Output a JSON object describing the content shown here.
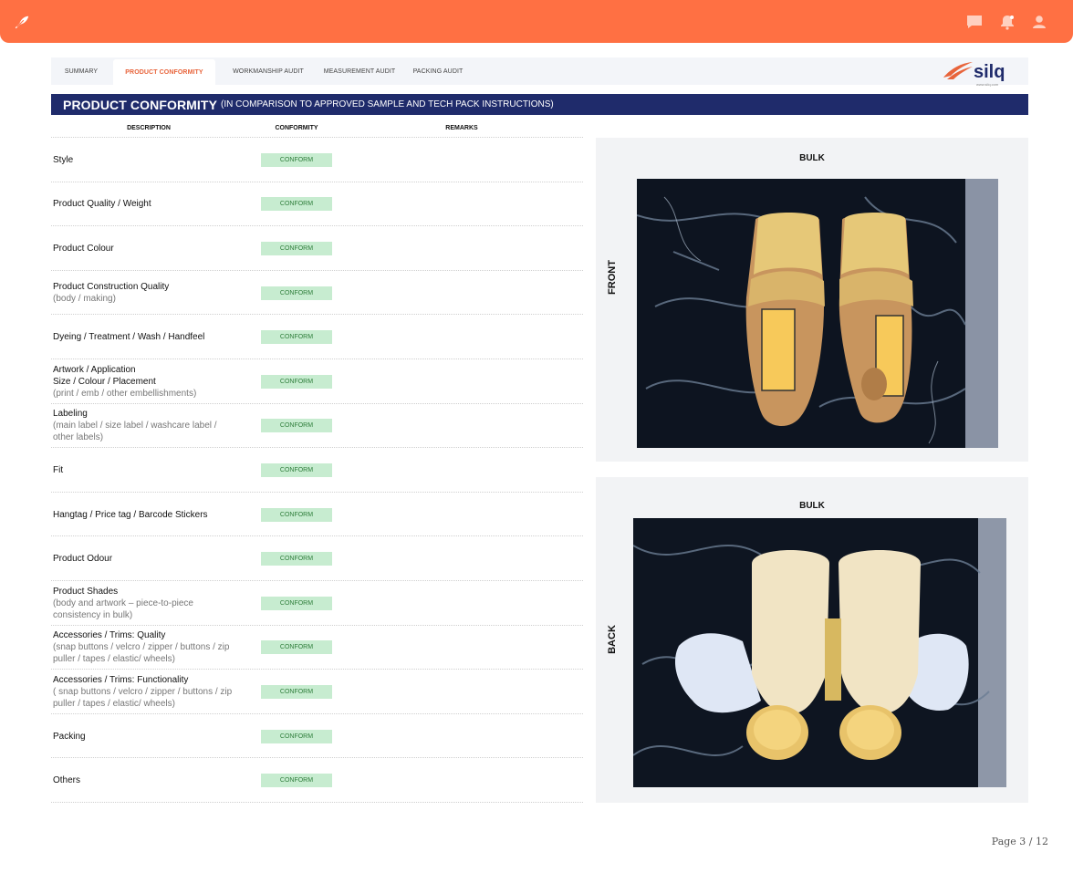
{
  "tabs": [
    {
      "label": "SUMMARY",
      "active": false
    },
    {
      "label": "PRODUCT CONFORMITY",
      "active": true
    },
    {
      "label": "WORKMANSHIP AUDIT",
      "active": false
    },
    {
      "label": "MEASUREMENT AUDIT",
      "active": false
    },
    {
      "label": "PACKING AUDIT",
      "active": false
    }
  ],
  "brand": {
    "name": "silq",
    "tagline": "www.silq.com",
    "accent": "#ff7043",
    "navy": "#1f2b6b"
  },
  "topbar_icons": [
    "feather-logo-icon",
    "chat-icon",
    "notification-bell-icon",
    "user-icon"
  ],
  "banner": {
    "title": "PRODUCT CONFORMITY",
    "subtitle": "(IN COMPARISON TO APPROVED SAMPLE AND TECH PACK INSTRUCTIONS)"
  },
  "columns": {
    "description": "DESCRIPTION",
    "conformity": "CONFORMITY",
    "remarks": "REMARKS"
  },
  "rows": [
    {
      "title": "Style",
      "sub": "",
      "status": "CONFORM"
    },
    {
      "title": "Product Quality / Weight",
      "sub": "",
      "status": "CONFORM"
    },
    {
      "title": "Product Colour",
      "sub": "",
      "status": "CONFORM"
    },
    {
      "title": "Product Construction Quality",
      "sub": "(body / making)",
      "status": "CONFORM"
    },
    {
      "title": "Dyeing / Treatment / Wash / Handfeel",
      "sub": "",
      "status": "CONFORM"
    },
    {
      "title": "Artwork / Application\nSize / Colour / Placement",
      "sub": "(print / emb / other embellishments)",
      "status": "CONFORM"
    },
    {
      "title": "Labeling",
      "sub": "(main label / size label / washcare label /\nother labels)",
      "status": "CONFORM"
    },
    {
      "title": "Fit",
      "sub": "",
      "status": "CONFORM"
    },
    {
      "title": "Hangtag / Price tag /  Barcode Stickers",
      "sub": "",
      "status": "CONFORM"
    },
    {
      "title": "Product Odour",
      "sub": "",
      "status": "CONFORM"
    },
    {
      "title": "Product Shades",
      "sub": "(body and artwork – piece-to-piece\nconsistency in bulk)",
      "status": "CONFORM"
    },
    {
      "title": "Accessories / Trims: Quality",
      "sub": "(snap buttons / velcro / zipper / buttons / zip\npuller / tapes / elastic/ wheels)",
      "status": "CONFORM"
    },
    {
      "title": "Accessories / Trims: Functionality",
      "sub": "( snap buttons / velcro / zipper / buttons / zip\npuller / tapes / elastic/ wheels)",
      "status": "CONFORM"
    },
    {
      "title": "Packing",
      "sub": "",
      "status": "CONFORM"
    },
    {
      "title": "Others",
      "sub": "",
      "status": "CONFORM"
    }
  ],
  "panels": [
    {
      "title": "BULK",
      "view": "FRONT"
    },
    {
      "title": "BULK",
      "view": "BACK"
    }
  ],
  "page": {
    "label": "Page 3 / 12",
    "current": 3,
    "total": 12
  }
}
